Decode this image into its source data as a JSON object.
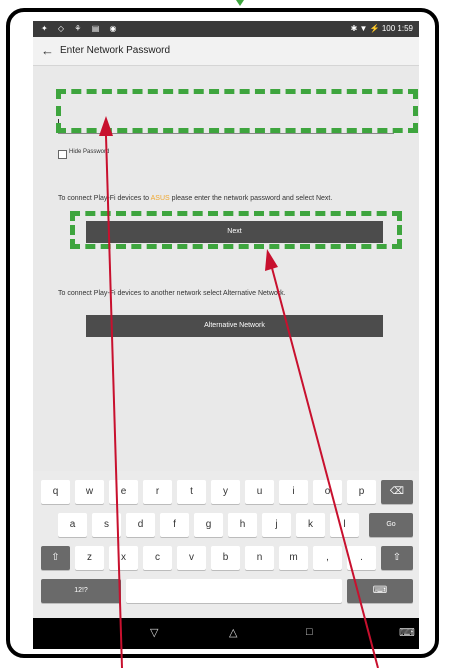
{
  "status_bar": {
    "left_icons": "✦ ◇ ⚘ ▤ ◉",
    "right_text": "✱ ▼ ⚡ 100  1:59"
  },
  "app_bar": {
    "back_icon": "←",
    "title": "Enter Network Password"
  },
  "password": {
    "value": "",
    "hide_label": "Hide Password"
  },
  "connect": {
    "text_before": "To connect Play-Fi devices to ",
    "network": "ASUS",
    "text_after": " please enter the network password and select Next.",
    "next_label": "Next"
  },
  "alternative": {
    "text": "To connect Play-Fi devices to another network select Alternative Network.",
    "button_label": "Alternative Network"
  },
  "keyboard": {
    "row1": [
      "q",
      "w",
      "e",
      "r",
      "t",
      "y",
      "u",
      "i",
      "o",
      "p"
    ],
    "row2": [
      "a",
      "s",
      "d",
      "f",
      "g",
      "h",
      "j",
      "k",
      "l"
    ],
    "row3": [
      "z",
      "x",
      "c",
      "v",
      "b",
      "n",
      "m",
      ",",
      "."
    ],
    "backspace": "⌫",
    "go": "Go",
    "shift": "⇧",
    "symbols": "12!?",
    "space": "",
    "ime": "⌨"
  },
  "nav": {
    "back": "▽",
    "home": "△",
    "recents": "□",
    "ime": "⌨"
  },
  "colors": {
    "accent": "#f0a830",
    "button": "#4c4c4c",
    "highlight": "#3ea53e",
    "arrow": "#c8102e"
  }
}
